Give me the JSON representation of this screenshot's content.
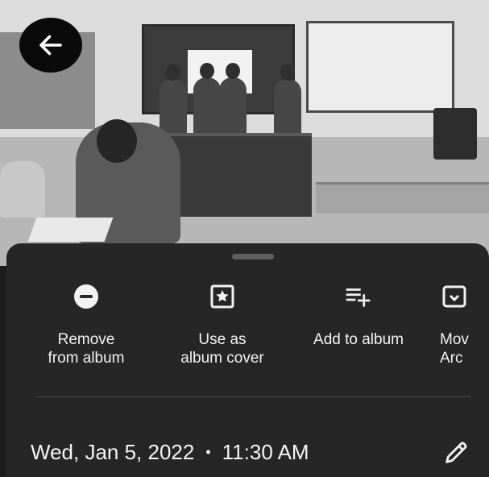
{
  "toolbar": {
    "back_icon": "arrow-left-icon"
  },
  "actions": [
    {
      "label": "Remove\nfrom album",
      "icon": "remove-circle-icon"
    },
    {
      "label": "Use as\nalbum cover",
      "icon": "album-cover-star-icon"
    },
    {
      "label": "Add to album",
      "icon": "playlist-add-icon"
    },
    {
      "label": "Mov\nArc",
      "icon": "archive-icon"
    }
  ],
  "details": {
    "date": "Wed, Jan 5, 2022",
    "separator": "•",
    "time": "11:30 AM",
    "edit_icon": "pencil-icon"
  },
  "colors": {
    "sheet": "#262626",
    "text": "#f2f2f2",
    "back_bg": "#0a0a0a"
  }
}
